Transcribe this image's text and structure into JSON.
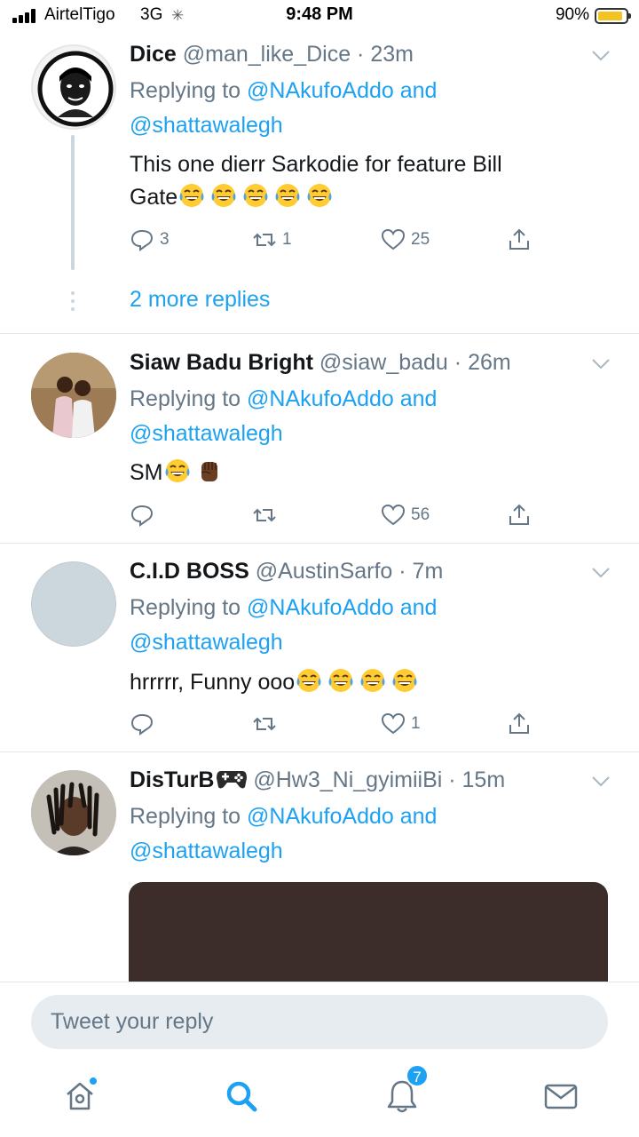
{
  "status_bar": {
    "carrier": "AirtelTigo",
    "network": "3G",
    "time": "9:48 PM",
    "battery_percent": "90%",
    "battery_level": 0.9
  },
  "tweets": [
    {
      "name": "Dice",
      "handle": "@man_like_Dice",
      "time": "23m",
      "replying_prefix": "Replying to",
      "mention_1": "@NAkufoAddo",
      "and": "and",
      "mention_2": "@shattawalegh",
      "text_line1": "This one dierr  Sarkodie for feature Bill",
      "text_line2": "Gate",
      "emojis": [
        "tears-of-joy",
        "tears-of-joy",
        "tears-of-joy",
        "tears-of-joy",
        "tears-of-joy"
      ],
      "replies": "3",
      "retweets": "1",
      "likes": "25"
    },
    {
      "name": "Siaw Badu Bright",
      "handle": "@siaw_badu",
      "time": "26m",
      "replying_prefix": "Replying to",
      "mention_1": "@NAkufoAddo",
      "and": "and",
      "mention_2": "@shattawalegh",
      "text": "SM",
      "emojis": [
        "tears-of-joy",
        "raised-fist"
      ],
      "replies": "",
      "retweets": "",
      "likes": "56"
    },
    {
      "name": "C.I.D BOSS",
      "handle": "@AustinSarfo",
      "time": "7m",
      "replying_prefix": "Replying to",
      "mention_1": "@NAkufoAddo",
      "and": "and",
      "mention_2": "@shattawalegh",
      "text": "hrrrrr, Funny ooo",
      "emojis": [
        "tears-of-joy",
        "tears-of-joy",
        "tears-of-joy",
        "tears-of-joy"
      ],
      "replies": "",
      "retweets": "",
      "likes": "1"
    },
    {
      "name": "DisTurB",
      "name_emoji": "gamepad",
      "handle": "@Hw3_Ni_gyimiiBi",
      "time": "15m",
      "replying_prefix": "Replying to",
      "mention_1": "@NAkufoAddo",
      "and": "and",
      "mention_2": "@shattawalegh",
      "media_color": "#3c2d2a"
    }
  ],
  "more_replies": "2 more replies",
  "reply_box": {
    "placeholder": "Tweet your reply"
  },
  "tab_bar": {
    "home": "home-icon",
    "search": "search-icon",
    "notifications": "bell-icon",
    "notifications_badge": "7",
    "messages": "mail-icon"
  },
  "colors": {
    "accent": "#1da1f2",
    "secondary_text": "#657786",
    "divider": "#e1e8ed"
  }
}
